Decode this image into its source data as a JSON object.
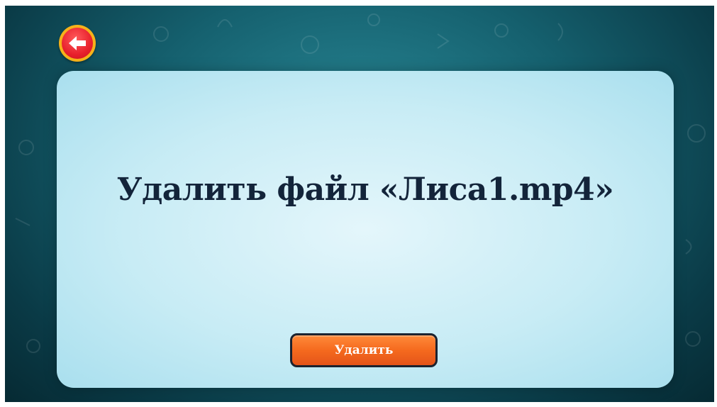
{
  "navigation": {
    "back_icon": "arrow-left-icon"
  },
  "dialog": {
    "message": "Удалить файл «Лиса1.mp4»",
    "delete_label": "Удалить"
  },
  "colors": {
    "background": "#15606e",
    "card": "#c8ecf5",
    "text": "#13243a",
    "button": "#f56a1e",
    "back_button": "#e8202c",
    "back_button_ring": "#f6b21a"
  }
}
